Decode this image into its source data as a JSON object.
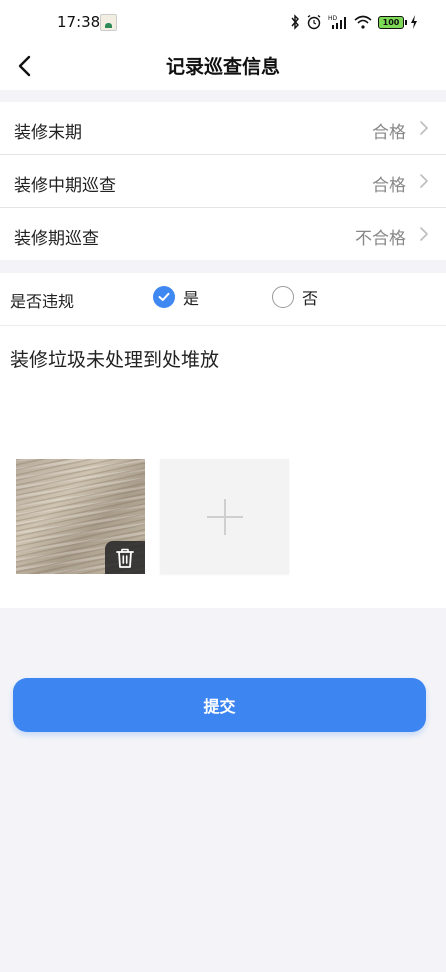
{
  "status_bar": {
    "time": "17:38",
    "battery_level": "100",
    "icons": [
      "bluetooth-icon",
      "alarm-icon",
      "hd-signal-icon",
      "wifi-icon",
      "battery-icon",
      "charging-icon"
    ]
  },
  "header": {
    "title": "记录巡查信息"
  },
  "inspections": [
    {
      "label": "装修末期",
      "value": "合格"
    },
    {
      "label": "装修中期巡查",
      "value": "合格"
    },
    {
      "label": "装修期巡查",
      "value": "不合格"
    }
  ],
  "violation": {
    "label": "是否违规",
    "options": [
      "是",
      "否"
    ],
    "selected": "是"
  },
  "description": "装修垃圾未处理到处堆放",
  "submit_label": "提交",
  "colors": {
    "accent": "#3d86f2",
    "value_text": "#888888",
    "page_bg": "#f4f4f8"
  }
}
